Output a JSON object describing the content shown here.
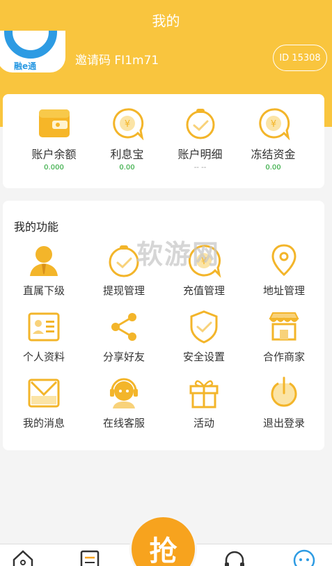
{
  "header": {
    "title": "我的",
    "avatar_brand": "融e通",
    "invite_code": "邀请码 FI1m71",
    "user_id": "ID 15308"
  },
  "stats": [
    {
      "label": "账户余额",
      "value": "0.000",
      "value_color": "#1aa02a",
      "icon": "wallet-icon"
    },
    {
      "label": "利息宝",
      "value": "0.00",
      "value_color": "#1aa02a",
      "icon": "yen-bubble-icon"
    },
    {
      "label": "账户明细",
      "value": "-- --",
      "value_color": "#999999",
      "icon": "check-bubble-icon"
    },
    {
      "label": "冻结资金",
      "value": "0.00",
      "value_color": "#1aa02a",
      "icon": "yen-bubble-icon"
    }
  ],
  "functions": {
    "title": "我的功能",
    "items": [
      {
        "label": "直属下级",
        "icon": "person-tie-icon"
      },
      {
        "label": "提现管理",
        "icon": "check-bubble-icon"
      },
      {
        "label": "充值管理",
        "icon": "yen-bubble-icon"
      },
      {
        "label": "地址管理",
        "icon": "location-pin-icon"
      },
      {
        "label": "个人资料",
        "icon": "id-card-icon"
      },
      {
        "label": "分享好友",
        "icon": "share-icon"
      },
      {
        "label": "安全设置",
        "icon": "shield-check-icon"
      },
      {
        "label": "合作商家",
        "icon": "store-icon"
      },
      {
        "label": "我的消息",
        "icon": "envelope-icon"
      },
      {
        "label": "在线客服",
        "icon": "headset-agent-icon"
      },
      {
        "label": "活动",
        "icon": "gift-icon"
      },
      {
        "label": "退出登录",
        "icon": "power-icon"
      }
    ]
  },
  "watermark": "软游网",
  "bottom_nav": {
    "grab_label": "抢",
    "items": [
      "home-icon",
      "orders-icon",
      "support-icon",
      "profile-icon"
    ]
  },
  "colors": {
    "brand_yellow": "#f9c53e",
    "icon_gold": "#f3b52a",
    "grab_orange": "#f7a31e",
    "avatar_blue": "#2d9be3"
  }
}
